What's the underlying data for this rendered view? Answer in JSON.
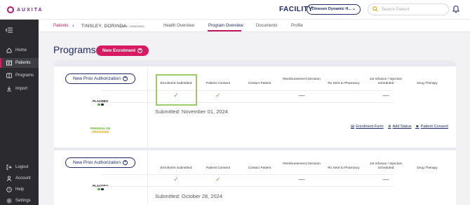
{
  "app": {
    "logo_text": "AUXITA",
    "facility_label": "FACILITY",
    "facility_value": "Dinesen Dynamic H...",
    "search_placeholder": "Search Patient"
  },
  "sidebar": {
    "items": [
      {
        "label": "Home",
        "icon": "home-icon"
      },
      {
        "label": "Patients",
        "icon": "patients-icon",
        "active": true
      },
      {
        "label": "Programs",
        "icon": "programs-icon"
      },
      {
        "label": "Import",
        "icon": "import-icon"
      },
      {
        "label": "Logout",
        "icon": "logout-icon"
      },
      {
        "label": "Account",
        "icon": "account-icon"
      },
      {
        "label": "Help",
        "icon": "help-icon"
      },
      {
        "label": "Settings",
        "icon": "settings-icon"
      }
    ]
  },
  "subheader": {
    "breadcrumb_link": "Patients",
    "patient_name": "TINSLEY, DORINDA",
    "patient_meta": "(25, F, 1999/05/09)",
    "tabs": [
      "Health Overview",
      "Program Overview",
      "Documents",
      "Profile"
    ],
    "active_tab": "Program Overview"
  },
  "page": {
    "title": "Programs",
    "new_enrolment_label": "New Enrolment"
  },
  "columns": [
    "Enrolment Submitted",
    "Patient Consent",
    "Contact Patient",
    "Reimbursement Decision",
    "Rx Sent to Pharmacy",
    "1st Infusion / Injection Scheduled",
    "Drug Therapy"
  ],
  "programs": [
    {
      "prior_auth_label": "New Prior Authorization",
      "brand": "PLACEBO",
      "partner_logo_top": "PREEMALAB",
      "partner_logo_bottom": "PROGRAM",
      "status": [
        "check",
        "check",
        "",
        "dash",
        "",
        "dash",
        ""
      ],
      "submitted": "Submitted: November 01, 2024",
      "links": [
        "Enrolment Form",
        "Add Status",
        "Patient Consent"
      ]
    },
    {
      "prior_auth_label": "New Prior Authorization",
      "brand": "PLACEBO",
      "status": [
        "check",
        "check",
        "",
        "dash",
        "",
        "dash",
        ""
      ],
      "submitted": "Submitted: October 28, 2024"
    }
  ],
  "colors": {
    "accent": "#d81b60",
    "navy": "#1d2a6a",
    "check": "#5cae3f",
    "highlight": "#9ccc65",
    "sidebar": "#2b2b2f"
  }
}
